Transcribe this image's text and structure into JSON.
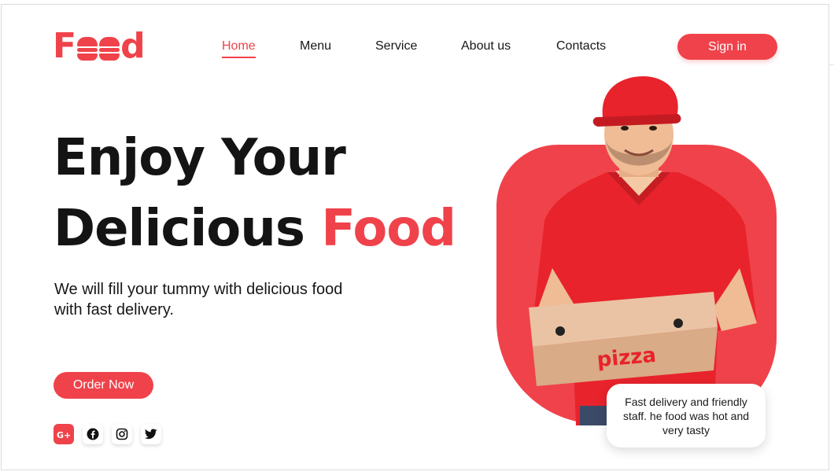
{
  "brand": {
    "logo_first": "F",
    "logo_last": "d",
    "accent_color": "#f0424a"
  },
  "nav": {
    "items": [
      {
        "label": "Home",
        "active": true
      },
      {
        "label": "Menu",
        "active": false
      },
      {
        "label": "Service",
        "active": false
      },
      {
        "label": "About us",
        "active": false
      },
      {
        "label": "Contacts",
        "active": false
      }
    ]
  },
  "header": {
    "signin_label": "Sign in"
  },
  "hero": {
    "headline_line1": "Enjoy Your",
    "headline_line2_plain": "Delicious ",
    "headline_line2_accent": "Food",
    "subtext": "We will fill your tummy with delicious food with fast delivery.",
    "cta_label": "Order Now"
  },
  "socials": [
    {
      "icon": "google-plus-icon"
    },
    {
      "icon": "facebook-icon"
    },
    {
      "icon": "instagram-icon"
    },
    {
      "icon": "twitter-icon"
    }
  ],
  "illustration": {
    "box_print": "pizza"
  },
  "review": {
    "text": "Fast delivery and friendly staff. he food was hot and very tasty"
  }
}
